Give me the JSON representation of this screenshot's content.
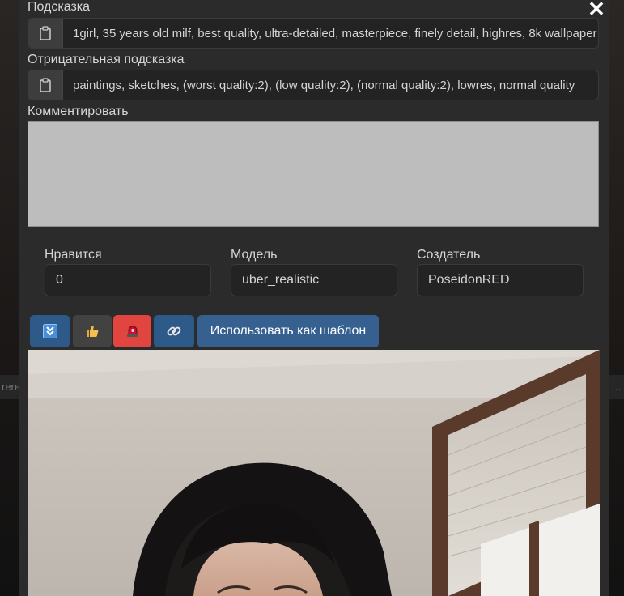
{
  "modal": {
    "close_symbol": "✕",
    "prompt_label": "Подсказка",
    "prompt_value": "1girl, 35 years old milf,  best quality, ultra-detailed, masterpiece, finely detail, highres, 8k wallpaper",
    "negative_label": "Отрицательная подсказка",
    "negative_value": "paintings, sketches, (worst quality:2), (low quality:2), (normal quality:2), lowres, normal quality",
    "comment_label": "Комментировать",
    "comment_value": ""
  },
  "info": {
    "likes_label": "Нравится",
    "likes_value": "0",
    "model_label": "Модель",
    "model_value": "uber_realistic",
    "creator_label": "Создатель",
    "creator_value": "PoseidonRED"
  },
  "actions": {
    "template_label": "Использовать как шаблон"
  },
  "background": {
    "left_strip_text": "rere",
    "right_strip_text": "…"
  },
  "icons": {
    "clipboard": "clipboard-icon",
    "download": "download-icon",
    "like": "thumbs-up-icon",
    "report": "siren-icon",
    "link": "link-icon",
    "close": "close-icon"
  },
  "colors": {
    "modal_bg": "#2b2b2b",
    "accent_blue": "#2e5a8a",
    "report_red": "#e0463f"
  }
}
